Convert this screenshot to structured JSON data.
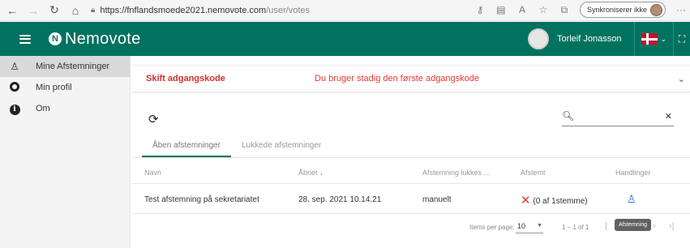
{
  "browser": {
    "url_host": "https://fnflandsmoede2021.nemovote.com",
    "url_path": "/user/votes",
    "sync_label": "Synkroniserer ikke"
  },
  "header": {
    "logo_badge": "N",
    "logo_text": "Nemovote",
    "user_name": "Torleif Jonasson",
    "brand_color": "#00725f"
  },
  "sidebar": {
    "items": [
      {
        "label": "Mine Afstemninger",
        "icon": "vote-user-icon",
        "active": true
      },
      {
        "label": "Min profil",
        "icon": "profile-icon",
        "active": false
      },
      {
        "label": "Om",
        "icon": "info-icon",
        "active": false
      }
    ]
  },
  "banner": {
    "title": "Skift adgangskode",
    "message": "Du bruger stadig den første adgangskode",
    "color": "#e53935"
  },
  "votes": {
    "search_placeholder": "",
    "tabs": [
      {
        "label": "Åben afstemninger",
        "active": true
      },
      {
        "label": "Lukkede afstemninger",
        "active": false
      }
    ],
    "columns": [
      "Navn",
      "Åbnet",
      "Afstemning lukkes ...",
      "Afstemt",
      "Handlinger"
    ],
    "sort_indicator": "↓",
    "rows": [
      {
        "name": "Test afstemning på sekretariatet",
        "opened": "28. sep. 2021 10.14.21",
        "closes": "manuelt",
        "voted": "(0 af 1stemme)"
      }
    ],
    "paginator": {
      "items_per_page_label": "Items per page:",
      "items_per_page": "10",
      "range": "1 – 1 of 1",
      "tooltip": "Afstemning"
    }
  }
}
